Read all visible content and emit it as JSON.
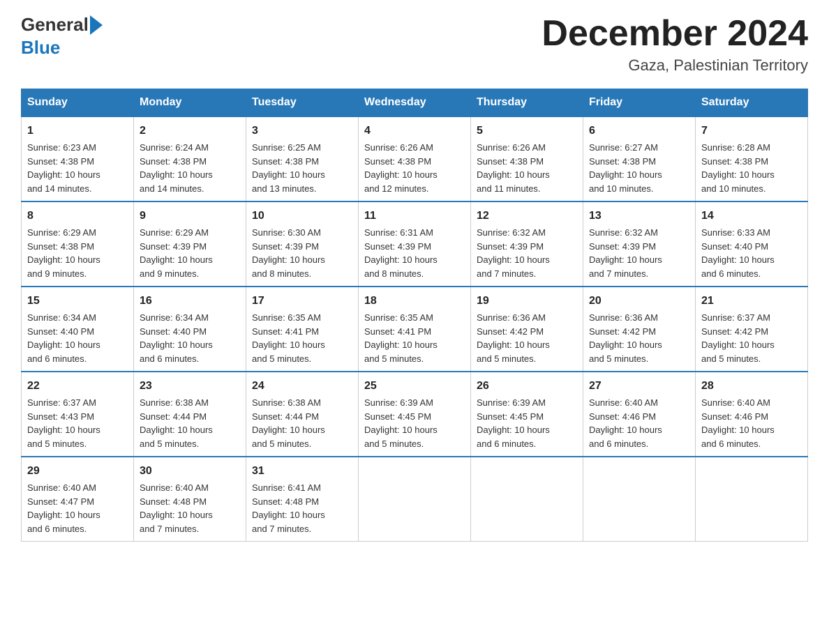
{
  "header": {
    "logo_general": "General",
    "logo_blue": "Blue",
    "month_title": "December 2024",
    "location": "Gaza, Palestinian Territory"
  },
  "days_of_week": [
    "Sunday",
    "Monday",
    "Tuesday",
    "Wednesday",
    "Thursday",
    "Friday",
    "Saturday"
  ],
  "weeks": [
    [
      {
        "day": "1",
        "sunrise": "6:23 AM",
        "sunset": "4:38 PM",
        "daylight": "10 hours and 14 minutes."
      },
      {
        "day": "2",
        "sunrise": "6:24 AM",
        "sunset": "4:38 PM",
        "daylight": "10 hours and 14 minutes."
      },
      {
        "day": "3",
        "sunrise": "6:25 AM",
        "sunset": "4:38 PM",
        "daylight": "10 hours and 13 minutes."
      },
      {
        "day": "4",
        "sunrise": "6:26 AM",
        "sunset": "4:38 PM",
        "daylight": "10 hours and 12 minutes."
      },
      {
        "day": "5",
        "sunrise": "6:26 AM",
        "sunset": "4:38 PM",
        "daylight": "10 hours and 11 minutes."
      },
      {
        "day": "6",
        "sunrise": "6:27 AM",
        "sunset": "4:38 PM",
        "daylight": "10 hours and 10 minutes."
      },
      {
        "day": "7",
        "sunrise": "6:28 AM",
        "sunset": "4:38 PM",
        "daylight": "10 hours and 10 minutes."
      }
    ],
    [
      {
        "day": "8",
        "sunrise": "6:29 AM",
        "sunset": "4:38 PM",
        "daylight": "10 hours and 9 minutes."
      },
      {
        "day": "9",
        "sunrise": "6:29 AM",
        "sunset": "4:39 PM",
        "daylight": "10 hours and 9 minutes."
      },
      {
        "day": "10",
        "sunrise": "6:30 AM",
        "sunset": "4:39 PM",
        "daylight": "10 hours and 8 minutes."
      },
      {
        "day": "11",
        "sunrise": "6:31 AM",
        "sunset": "4:39 PM",
        "daylight": "10 hours and 8 minutes."
      },
      {
        "day": "12",
        "sunrise": "6:32 AM",
        "sunset": "4:39 PM",
        "daylight": "10 hours and 7 minutes."
      },
      {
        "day": "13",
        "sunrise": "6:32 AM",
        "sunset": "4:39 PM",
        "daylight": "10 hours and 7 minutes."
      },
      {
        "day": "14",
        "sunrise": "6:33 AM",
        "sunset": "4:40 PM",
        "daylight": "10 hours and 6 minutes."
      }
    ],
    [
      {
        "day": "15",
        "sunrise": "6:34 AM",
        "sunset": "4:40 PM",
        "daylight": "10 hours and 6 minutes."
      },
      {
        "day": "16",
        "sunrise": "6:34 AM",
        "sunset": "4:40 PM",
        "daylight": "10 hours and 6 minutes."
      },
      {
        "day": "17",
        "sunrise": "6:35 AM",
        "sunset": "4:41 PM",
        "daylight": "10 hours and 5 minutes."
      },
      {
        "day": "18",
        "sunrise": "6:35 AM",
        "sunset": "4:41 PM",
        "daylight": "10 hours and 5 minutes."
      },
      {
        "day": "19",
        "sunrise": "6:36 AM",
        "sunset": "4:42 PM",
        "daylight": "10 hours and 5 minutes."
      },
      {
        "day": "20",
        "sunrise": "6:36 AM",
        "sunset": "4:42 PM",
        "daylight": "10 hours and 5 minutes."
      },
      {
        "day": "21",
        "sunrise": "6:37 AM",
        "sunset": "4:42 PM",
        "daylight": "10 hours and 5 minutes."
      }
    ],
    [
      {
        "day": "22",
        "sunrise": "6:37 AM",
        "sunset": "4:43 PM",
        "daylight": "10 hours and 5 minutes."
      },
      {
        "day": "23",
        "sunrise": "6:38 AM",
        "sunset": "4:44 PM",
        "daylight": "10 hours and 5 minutes."
      },
      {
        "day": "24",
        "sunrise": "6:38 AM",
        "sunset": "4:44 PM",
        "daylight": "10 hours and 5 minutes."
      },
      {
        "day": "25",
        "sunrise": "6:39 AM",
        "sunset": "4:45 PM",
        "daylight": "10 hours and 5 minutes."
      },
      {
        "day": "26",
        "sunrise": "6:39 AM",
        "sunset": "4:45 PM",
        "daylight": "10 hours and 6 minutes."
      },
      {
        "day": "27",
        "sunrise": "6:40 AM",
        "sunset": "4:46 PM",
        "daylight": "10 hours and 6 minutes."
      },
      {
        "day": "28",
        "sunrise": "6:40 AM",
        "sunset": "4:46 PM",
        "daylight": "10 hours and 6 minutes."
      }
    ],
    [
      {
        "day": "29",
        "sunrise": "6:40 AM",
        "sunset": "4:47 PM",
        "daylight": "10 hours and 6 minutes."
      },
      {
        "day": "30",
        "sunrise": "6:40 AM",
        "sunset": "4:48 PM",
        "daylight": "10 hours and 7 minutes."
      },
      {
        "day": "31",
        "sunrise": "6:41 AM",
        "sunset": "4:48 PM",
        "daylight": "10 hours and 7 minutes."
      },
      {
        "day": "",
        "sunrise": "",
        "sunset": "",
        "daylight": ""
      },
      {
        "day": "",
        "sunrise": "",
        "sunset": "",
        "daylight": ""
      },
      {
        "day": "",
        "sunrise": "",
        "sunset": "",
        "daylight": ""
      },
      {
        "day": "",
        "sunrise": "",
        "sunset": "",
        "daylight": ""
      }
    ]
  ],
  "labels": {
    "sunrise": "Sunrise:",
    "sunset": "Sunset:",
    "daylight": "Daylight:"
  }
}
